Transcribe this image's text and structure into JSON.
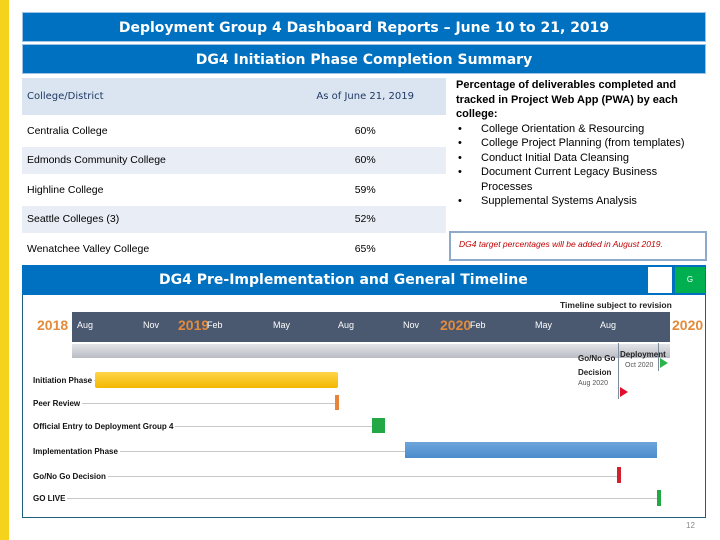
{
  "header": {
    "title": "Deployment Group 4 Dashboard Reports – June 10 to 21, 2019",
    "subtitle": "DG4 Initiation Phase Completion Summary"
  },
  "table": {
    "headers": [
      "College/District",
      "As of June 21, 2019"
    ],
    "rows": [
      [
        "Centralia College",
        "60%"
      ],
      [
        "Edmonds Community College",
        "60%"
      ],
      [
        "Highline College",
        "59%"
      ],
      [
        "Seattle Colleges (3)",
        "52%"
      ],
      [
        "Wenatchee Valley College",
        "65%"
      ]
    ]
  },
  "info": {
    "intro": "Percentage of deliverables completed and tracked in Project Web App (PWA) by each college:",
    "items": [
      "College Orientation & Resourcing",
      "College Project Planning (from templates)",
      "Conduct Initial Data Cleansing",
      "Document Current Legacy Business Processes",
      "Supplemental Systems Analysis"
    ],
    "note": "DG4 target percentages will be added in August 2019."
  },
  "timeline": {
    "title": "DG4 Pre-Implementation and General Timeline",
    "status": "G",
    "status_color": "#00B050",
    "revision_note": "Timeline subject to revision",
    "years": [
      "2018",
      "2019",
      "2020",
      "2020"
    ],
    "months": [
      "Aug",
      "Nov",
      "Feb",
      "May",
      "Aug",
      "Nov",
      "Feb",
      "May",
      "Aug"
    ],
    "gonogo_label": "Go/No Go Decision",
    "gonogo_date": "Aug 2020",
    "deploy_label": "Deployment",
    "deploy_date": "Oct 2020",
    "tasks": [
      "Initiation Phase",
      "Peer Review",
      "Official Entry to Deployment Group 4",
      "Implementation Phase",
      "Go/No Go Decision",
      "GO LIVE"
    ]
  },
  "page_number": "12"
}
